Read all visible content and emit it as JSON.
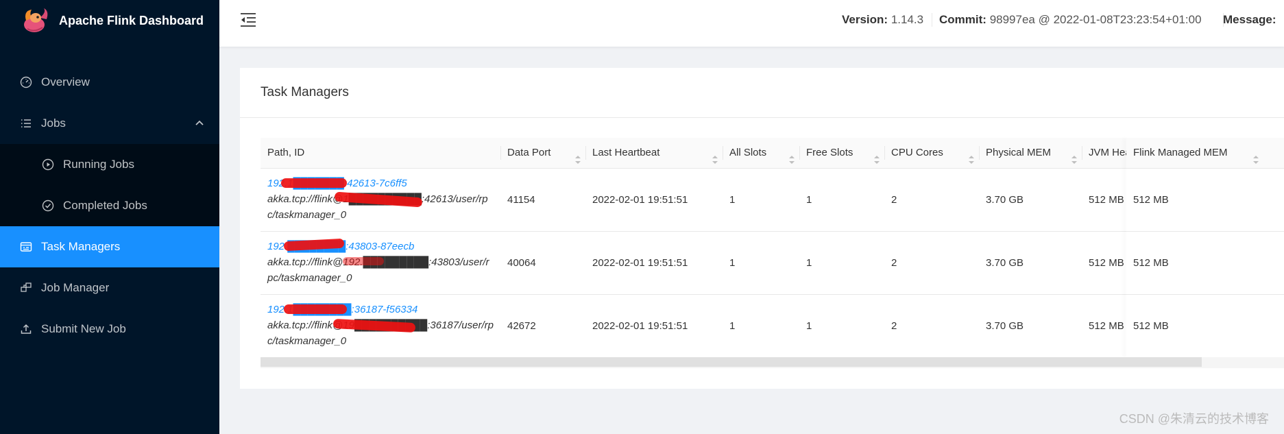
{
  "app": {
    "title": "Apache Flink Dashboard"
  },
  "sidebar": {
    "items": [
      {
        "label": "Overview",
        "icon": "dashboard-icon"
      },
      {
        "label": "Jobs",
        "icon": "list-icon"
      },
      {
        "label": "Running Jobs",
        "icon": "play-circle-icon"
      },
      {
        "label": "Completed Jobs",
        "icon": "check-circle-icon"
      },
      {
        "label": "Task Managers",
        "icon": "task-managers-icon"
      },
      {
        "label": "Job Manager",
        "icon": "cluster-icon"
      },
      {
        "label": "Submit New Job",
        "icon": "upload-icon"
      }
    ]
  },
  "header": {
    "version_label": "Version:",
    "version": "1.14.3",
    "commit_label": "Commit:",
    "commit": "98997ea @ 2022-01-08T23:23:54+01:00",
    "message_label": "Message:"
  },
  "card": {
    "title": "Task Managers"
  },
  "table": {
    "columns": [
      "Path, ID",
      "Data Port",
      "Last Heartbeat",
      "All Slots",
      "Free Slots",
      "CPU Cores",
      "Physical MEM",
      "JVM Heap",
      "Flink Managed MEM"
    ],
    "rows": [
      {
        "id": "192.1███████:42613-7c6ff5",
        "path": "akka.tcp://flink@1██████████:42613/user/rpc/taskmanager_0",
        "data_port": "41154",
        "heartbeat": "2022-02-01 19:51:51",
        "all_slots": "1",
        "free_slots": "1",
        "cpu": "2",
        "physical_mem": "3.70 GB",
        "jvm_heap": "512 MB",
        "managed_mem": "512 MB"
      },
      {
        "id": "192.████████:43803-87eecb",
        "path": "akka.tcp://flink@192.█████████:43803/user/rpc/taskmanager_0",
        "data_port": "40064",
        "heartbeat": "2022-02-01 19:51:51",
        "all_slots": "1",
        "free_slots": "1",
        "cpu": "2",
        "physical_mem": "3.70 GB",
        "jvm_heap": "512 MB",
        "managed_mem": "512 MB"
      },
      {
        "id": "192.1████████:36187-f56334",
        "path": "akka.tcp://flink@19██████████:36187/user/rpc/taskmanager_0",
        "data_port": "42672",
        "heartbeat": "2022-02-01 19:51:51",
        "all_slots": "1",
        "free_slots": "1",
        "cpu": "2",
        "physical_mem": "3.70 GB",
        "jvm_heap": "512 MB",
        "managed_mem": "512 MB"
      }
    ]
  },
  "watermark": "CSDN @朱清云的技术博客",
  "colors": {
    "sidebar_bg": "#001529",
    "submenu_bg": "#000c17",
    "active": "#1890ff",
    "link": "#1890ff",
    "redaction": "#ee1111"
  }
}
